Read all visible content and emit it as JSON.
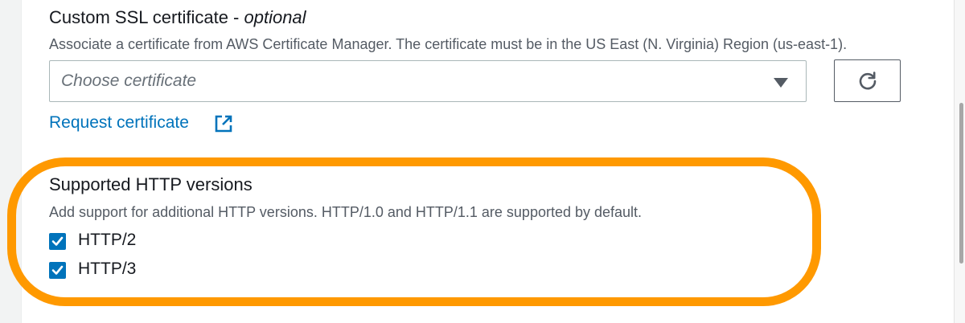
{
  "certificate": {
    "label": "Custom SSL certificate - ",
    "label_optional": "optional",
    "description": "Associate a certificate from AWS Certificate Manager. The certificate must be in the US East (N. Virginia) Region (us-east-1).",
    "select_placeholder": "Choose certificate",
    "request_link": "Request certificate",
    "icons": {
      "dropdown": "caret-down-icon",
      "refresh": "refresh-icon",
      "external": "external-link-icon"
    }
  },
  "http_versions": {
    "title": "Supported HTTP versions",
    "description": "Add support for additional HTTP versions. HTTP/1.0 and HTTP/1.1 are supported by default.",
    "options": [
      {
        "label": "HTTP/2",
        "checked": true
      },
      {
        "label": "HTTP/3",
        "checked": true
      }
    ]
  },
  "colors": {
    "accent": "#0073bb",
    "highlight": "#ff9900",
    "text": "#16191f",
    "muted": "#545b64"
  }
}
